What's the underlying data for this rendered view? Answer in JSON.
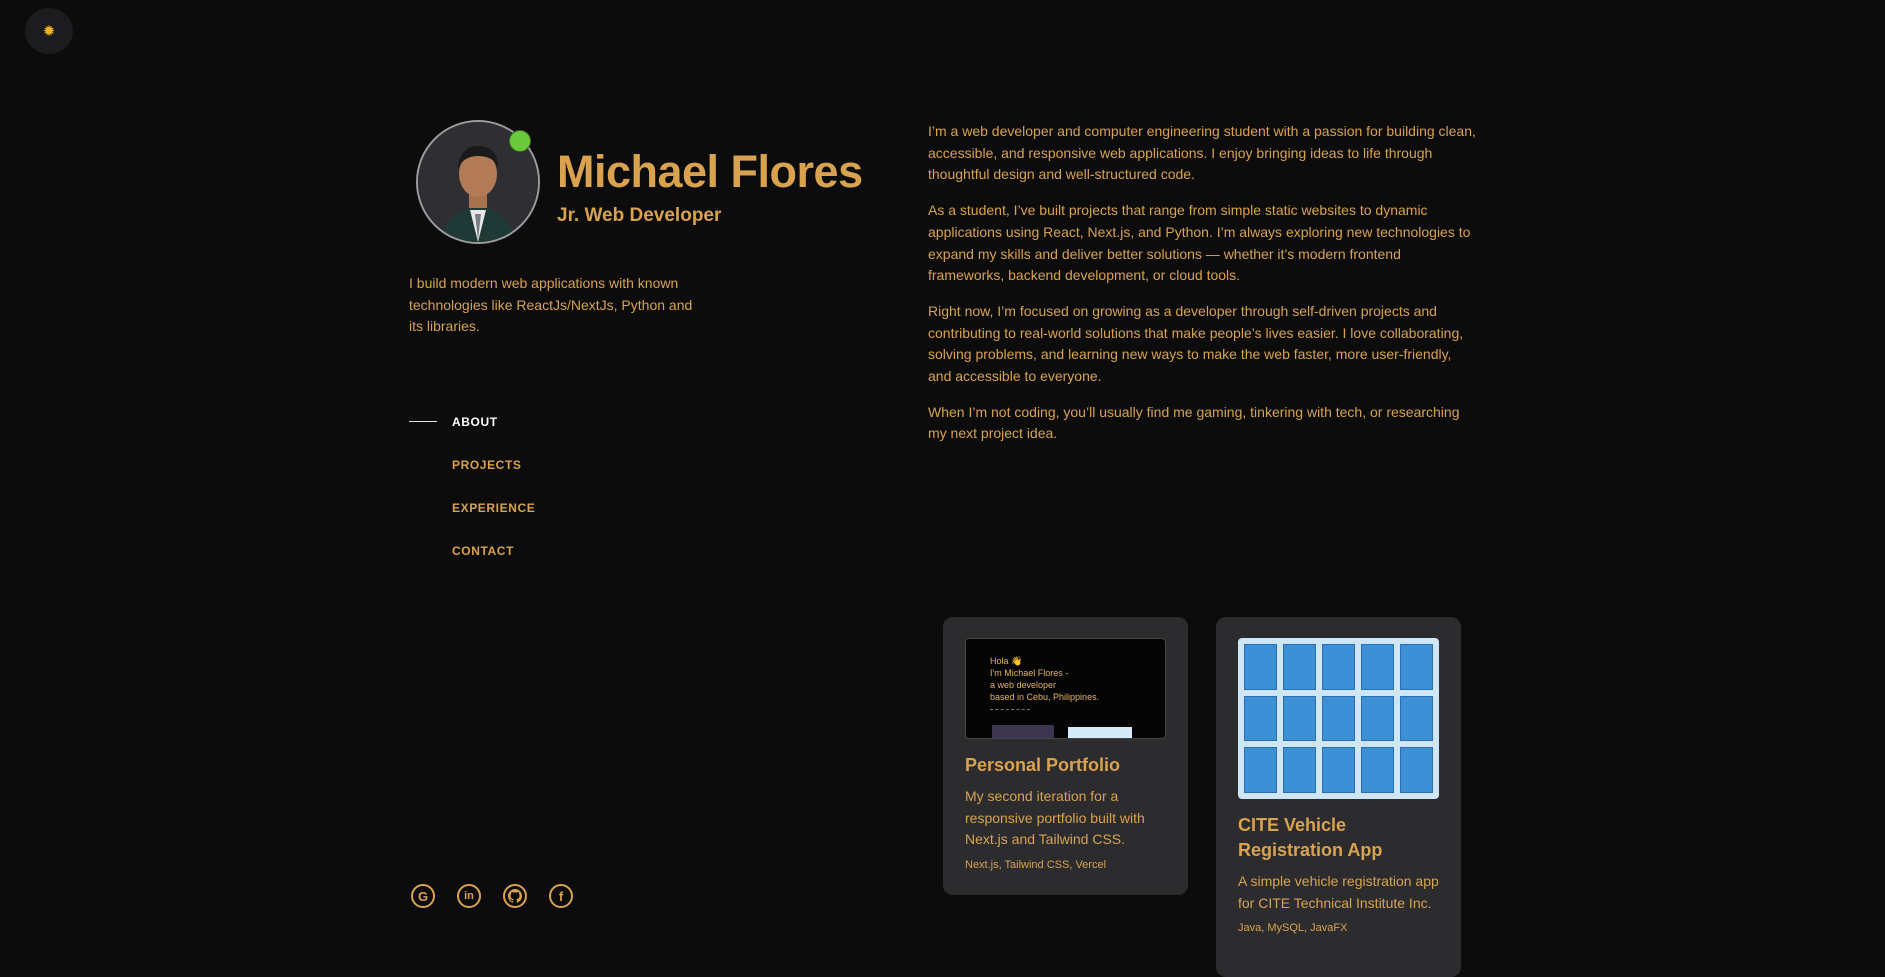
{
  "theme_toggle": {
    "icon": "sun-icon",
    "glyph": "✹"
  },
  "profile": {
    "name": "Michael Flores",
    "role": "Jr. Web Developer",
    "tagline": "I build modern web applications with known technologies like ReactJs/NextJs, Python and its libraries.",
    "status_color": "#6cc93a"
  },
  "nav": {
    "items": [
      {
        "label": "ABOUT",
        "active": true
      },
      {
        "label": "PROJECTS",
        "active": false
      },
      {
        "label": "EXPERIENCE",
        "active": false
      },
      {
        "label": "CONTACT",
        "active": false
      }
    ]
  },
  "about": {
    "paragraphs": [
      "I’m a web developer and computer engineering student with a passion for building clean, accessible, and responsive web applications. I enjoy bringing ideas to life through thoughtful design and well-structured code.",
      "As a student, I’ve built projects that range from simple static websites to dynamic applications using React, Next.js, and Python. I’m always exploring new technologies to expand my skills and deliver better solutions — whether it’s modern frontend frameworks, backend development, or cloud tools.",
      "Right now, I’m focused on growing as a developer through self-driven projects and contributing to real-world solutions that make people’s lives easier. I love collaborating, solving problems, and learning new ways to make the web faster, more user-friendly, and accessible to everyone.",
      "When I’m not coding, you’ll usually find me gaming, tinkering with tech, or researching my next project idea."
    ]
  },
  "projects": [
    {
      "title": "Personal Portfolio",
      "description": "My second iteration for a responsive portfolio built with Next.js and Tailwind CSS.",
      "tags": "Next.js, Tailwind CSS, Vercel",
      "thumb_text": [
        "Hola 👋",
        "I'm Michael Flores -",
        "a web developer",
        "based in Cebu, Philippines."
      ]
    },
    {
      "title": "CITE Vehicle Registration App",
      "description": "A simple vehicle registration app for CITE Technical Institute Inc.",
      "tags": "Java, MySQL, JavaFX"
    }
  ],
  "social": [
    {
      "icon": "google-icon",
      "glyph": "G"
    },
    {
      "icon": "linkedin-icon",
      "glyph": "in"
    },
    {
      "icon": "github-icon",
      "glyph": "⌥"
    },
    {
      "icon": "facebook-icon",
      "glyph": "f"
    }
  ],
  "colors": {
    "accent": "#d9a24f",
    "background": "#0c0c0d",
    "card": "#2c2c2f",
    "online": "#6cc93a"
  }
}
